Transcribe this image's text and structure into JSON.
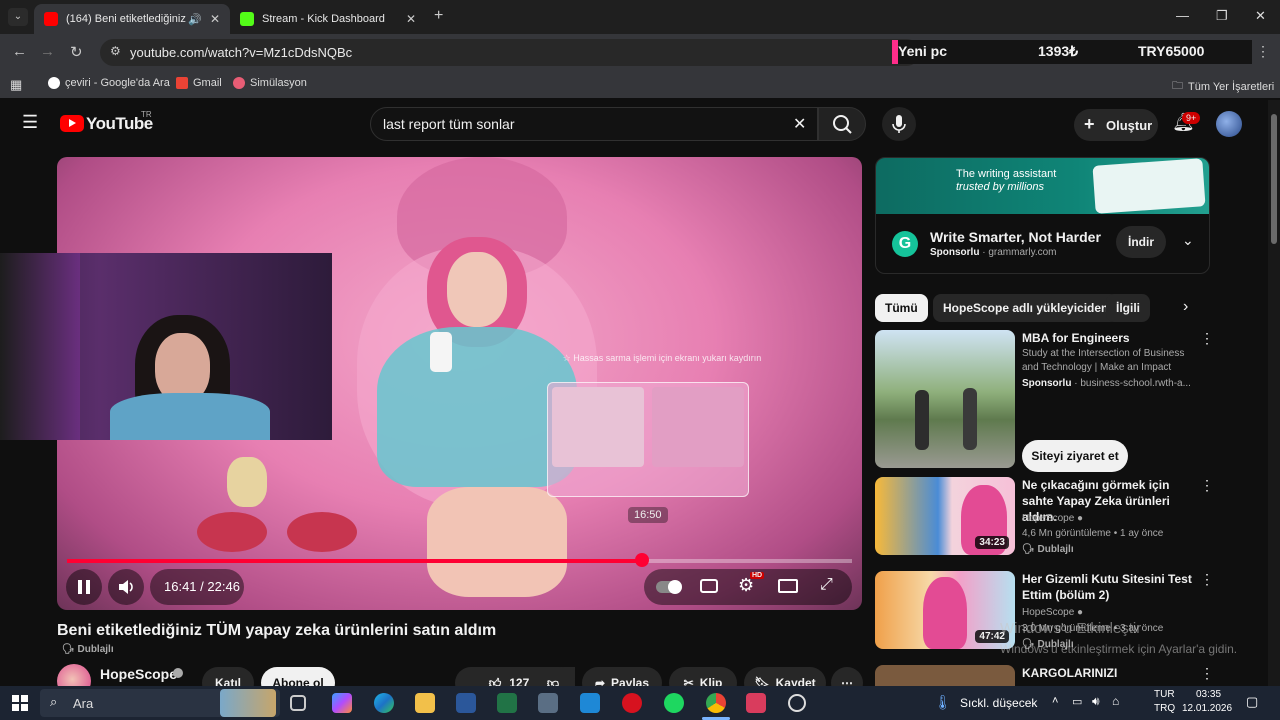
{
  "browser": {
    "tabs": [
      {
        "title": "(164) Beni etiketlediğiniz TÜ",
        "active": true
      },
      {
        "title": "Stream - Kick Dashboard",
        "active": false
      }
    ],
    "new_tab_symbol": "+",
    "url": "youtube.com/watch?v=Mz1cDdsNQBc",
    "bookmarks": [
      {
        "label": "çeviri - Google'da Ara",
        "icon": "google-icon"
      },
      {
        "label": "Gmail",
        "icon": "gmail-icon"
      },
      {
        "label": "Simülasyon",
        "icon": "site-icon"
      }
    ],
    "all_bookmarks_label": "Tüm Yer İşaretleri"
  },
  "stream_overlay": {
    "item": "Yeni pc",
    "current": "1393₺",
    "goal": "TRY65000"
  },
  "youtube": {
    "logo_text": "YouTube",
    "region": "TR",
    "search_query": "last report tüm sonlar",
    "create_label": "Oluştur",
    "notification_badge": "9+"
  },
  "player": {
    "current_time": "16:41",
    "separator": " / ",
    "duration": "22:46",
    "progress_fraction": 0.733,
    "hover_time": "16:50",
    "in_video_text": "☆ Hassas sarma işlemi için ekranı yukarı kaydırın",
    "hd_badge": "HD"
  },
  "video": {
    "title": "Beni etiketlediğiniz TÜM yapay zeka ürünlerini satın aldım",
    "dubbed_label": "Dublajlı",
    "channel": "HopeScope",
    "join_label": "Katıl",
    "subscribe_label": "Abone ol",
    "likes": "127 B",
    "share_label": "Paylaş",
    "clip_label": "Klip",
    "save_label": "Kaydet"
  },
  "ad": {
    "banner_line1": "The writing assistant",
    "banner_line2": "trusted by millions",
    "title": "Write Smarter, Not Harder",
    "sponsored": "Sponsorlu",
    "domain": "grammarly.com",
    "cta": "İndir"
  },
  "chips": [
    "Tümü",
    "HopeScope adlı yükleyiciden",
    "İlgili"
  ],
  "recommendations": [
    {
      "title": "MBA for Engineers",
      "description": "Study at the Intersection of Business and Technology | Make an Impact",
      "sponsored": "Sponsorlu",
      "domain": "business-school.rwth-a...",
      "cta": "Siteyi ziyaret et"
    },
    {
      "title": "Ne çıkacağını görmek için sahte Yapay Zeka ürünleri aldım.",
      "channel": "HopeScope",
      "stats": "4,6 Mn görüntüleme • 1 ay önce",
      "badge": "Dublajlı",
      "duration": "34:23"
    },
    {
      "title": "Her Gizemli Kutu Sitesini Test Ettim (bölüm 2)",
      "channel": "HopeScope",
      "stats": "3,0 Mn görüntüleme • 3 ay önce",
      "badge": "Dublajlı",
      "duration": "47:42"
    },
    {
      "title": "KARGOLARINIZI"
    }
  ],
  "windows_watermark": {
    "line1": "Windows'u Etkinleştir",
    "line2": "Windows'u etkinleştirmek için Ayarlar'a gidin."
  },
  "taskbar": {
    "search_placeholder": "Ara",
    "weather": "Sıckl. düşecek",
    "language_top": "TUR",
    "language_bottom": "TRQ",
    "time": "03:35",
    "date": "12.01.2026"
  }
}
